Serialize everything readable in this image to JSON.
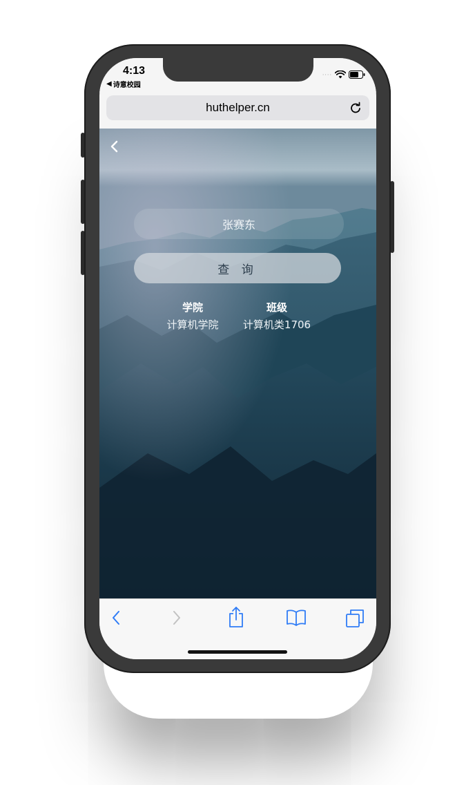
{
  "status": {
    "time": "4:13",
    "back_app": "诗意校园"
  },
  "browser": {
    "url": "huthelper.cn"
  },
  "form": {
    "name_value": "张赛东",
    "query_label": "查 询"
  },
  "result": {
    "college_header": "学院",
    "college_value": "计算机学院",
    "class_header": "班级",
    "class_value": "计算机类1706"
  },
  "colors": {
    "accent": "#2f7cf6",
    "query_text": "#2d3e4d"
  },
  "icons": [
    "back-chevron-icon",
    "wifi-icon",
    "battery-icon",
    "reload-icon",
    "toolbar-back-icon",
    "toolbar-forward-icon",
    "share-icon",
    "bookmarks-icon",
    "tabs-icon"
  ]
}
